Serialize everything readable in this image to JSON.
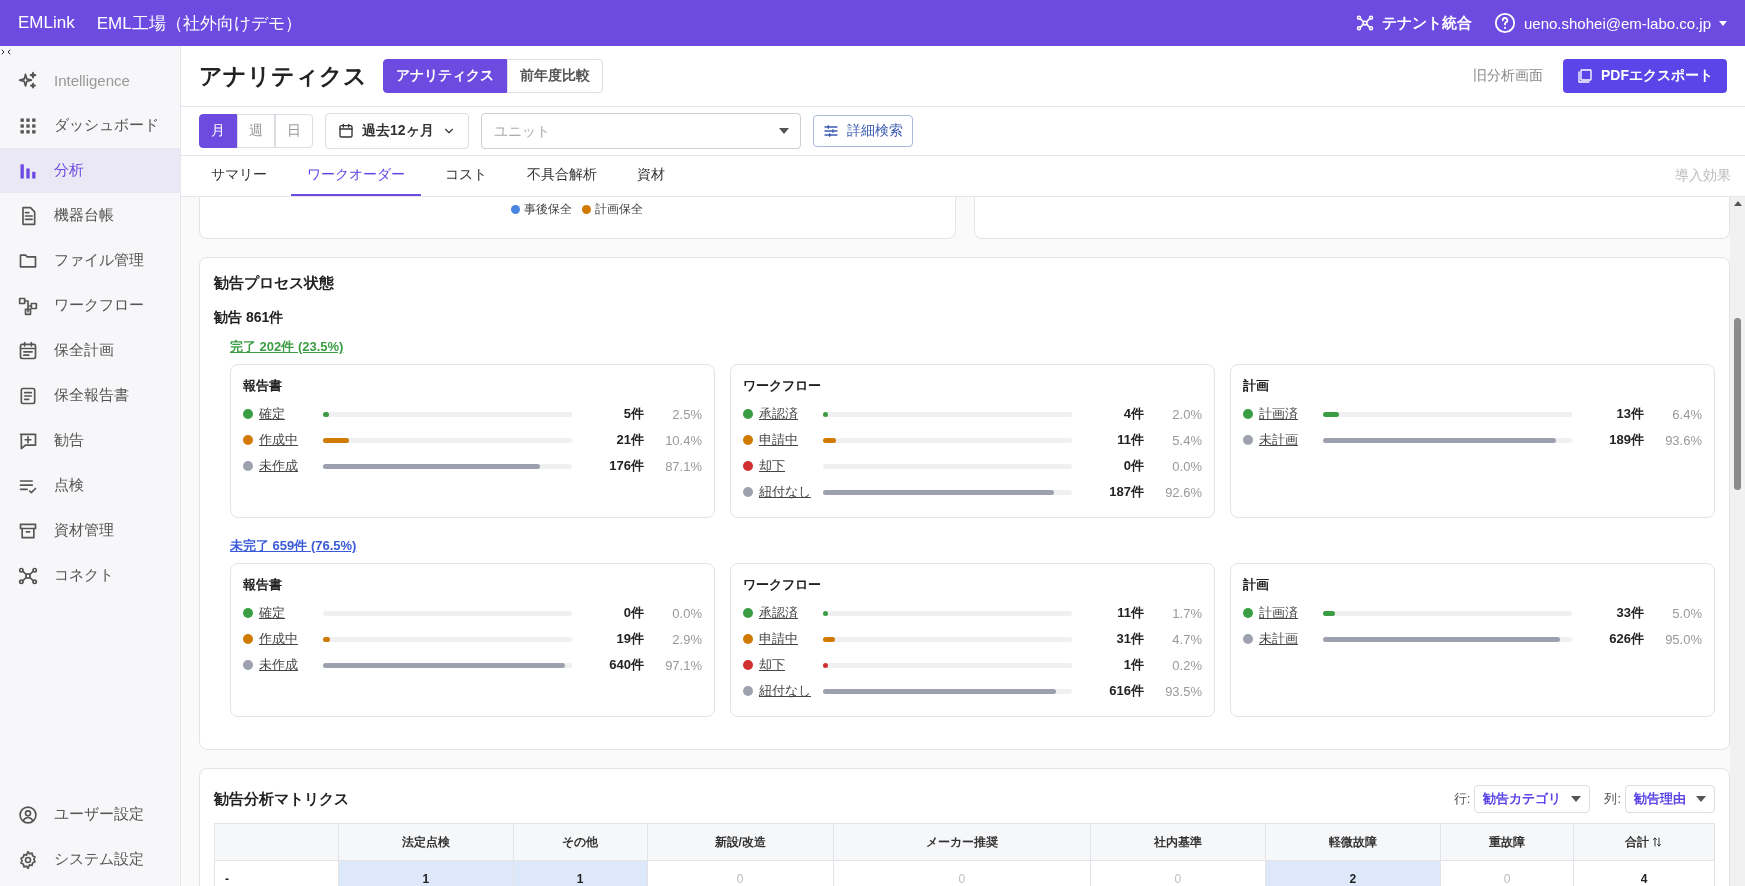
{
  "topbar": {
    "brand": "EMLink",
    "workspace": "EML工場（社外向けデモ）",
    "tenant": "テナント統合",
    "user": "ueno.shohei@em-labo.co.jp"
  },
  "sidebar": {
    "items": [
      {
        "label": "Intelligence",
        "selected": false,
        "disabled": true
      },
      {
        "label": "ダッシュボード",
        "selected": false,
        "disabled": false
      },
      {
        "label": "分析",
        "selected": true,
        "disabled": false
      },
      {
        "label": "機器台帳",
        "selected": false,
        "disabled": false
      },
      {
        "label": "ファイル管理",
        "selected": false,
        "disabled": false
      },
      {
        "label": "ワークフロー",
        "selected": false,
        "disabled": false
      },
      {
        "label": "保全計画",
        "selected": false,
        "disabled": false
      },
      {
        "label": "保全報告書",
        "selected": false,
        "disabled": false
      },
      {
        "label": "勧告",
        "selected": false,
        "disabled": false
      },
      {
        "label": "点検",
        "selected": false,
        "disabled": false
      },
      {
        "label": "資材管理",
        "selected": false,
        "disabled": false
      },
      {
        "label": "コネクト",
        "selected": false,
        "disabled": false
      }
    ],
    "bottom_items": [
      {
        "label": "ユーザー設定",
        "selected": false
      },
      {
        "label": "システム設定",
        "selected": false
      }
    ]
  },
  "header": {
    "title": "アナリティクス",
    "modes": [
      {
        "label": "アナリティクス",
        "selected": true
      },
      {
        "label": "前年度比較",
        "selected": false
      }
    ],
    "old_link": "旧分析画面",
    "export_button": "PDFエクスポート"
  },
  "filters": {
    "periods": [
      {
        "label": "月",
        "selected": true
      },
      {
        "label": "週",
        "selected": false
      },
      {
        "label": "日",
        "selected": false
      }
    ],
    "range": "過去12ヶ月",
    "unit_placeholder": "ユニット",
    "advanced_button": "詳細検索"
  },
  "tabs": [
    {
      "label": "サマリー",
      "selected": false
    },
    {
      "label": "ワークオーダー",
      "selected": true
    },
    {
      "label": "コスト",
      "selected": false
    },
    {
      "label": "不具合解析",
      "selected": false
    },
    {
      "label": "資材",
      "selected": false
    }
  ],
  "tab_right": {
    "label": "導入効果",
    "disabled": true
  },
  "top_legend": [
    {
      "label": "事後保全",
      "color": "#4a86e0"
    },
    {
      "label": "計画保全",
      "color": "#d17a00"
    }
  ],
  "process": {
    "title": "勧告プロセス状態",
    "total": "勧告 861件",
    "groups": [
      {
        "label": "完了 202件 (23.5%)",
        "kind": "done",
        "cards": [
          {
            "title": "報告書",
            "rows": [
              {
                "label": "確定",
                "color": "#3a9d44",
                "level": 0.025,
                "count": "5件",
                "pct": "2.5%"
              },
              {
                "label": "作成中",
                "color": "#d17a00",
                "level": 0.104,
                "count": "21件",
                "pct": "10.4%"
              },
              {
                "label": "未作成",
                "color": "#9ca1ad",
                "level": 0.871,
                "count": "176件",
                "pct": "87.1%"
              }
            ]
          },
          {
            "title": "ワークフロー",
            "rows": [
              {
                "label": "承認済",
                "color": "#3a9d44",
                "level": 0.02,
                "count": "4件",
                "pct": "2.0%"
              },
              {
                "label": "申請中",
                "color": "#d17a00",
                "level": 0.054,
                "count": "11件",
                "pct": "5.4%"
              },
              {
                "label": "却下",
                "color": "#d03030",
                "level": 0,
                "count": "0件",
                "pct": "0.0%"
              },
              {
                "label": "紐付なし",
                "color": "#9ca1ad",
                "level": 0.926,
                "count": "187件",
                "pct": "92.6%"
              }
            ]
          },
          {
            "title": "計画",
            "rows": [
              {
                "label": "計画済",
                "color": "#3a9d44",
                "level": 0.064,
                "count": "13件",
                "pct": "6.4%"
              },
              {
                "label": "未計画",
                "color": "#9ca1ad",
                "level": 0.936,
                "count": "189件",
                "pct": "93.6%"
              }
            ]
          }
        ]
      },
      {
        "label": "未完了 659件 (76.5%)",
        "kind": "open",
        "cards": [
          {
            "title": "報告書",
            "rows": [
              {
                "label": "確定",
                "color": "#3a9d44",
                "level": 0,
                "count": "0件",
                "pct": "0.0%"
              },
              {
                "label": "作成中",
                "color": "#d17a00",
                "level": 0.029,
                "count": "19件",
                "pct": "2.9%"
              },
              {
                "label": "未作成",
                "color": "#9ca1ad",
                "level": 0.971,
                "count": "640件",
                "pct": "97.1%"
              }
            ]
          },
          {
            "title": "ワークフロー",
            "rows": [
              {
                "label": "承認済",
                "color": "#3a9d44",
                "level": 0.017,
                "count": "11件",
                "pct": "1.7%"
              },
              {
                "label": "申請中",
                "color": "#d17a00",
                "level": 0.047,
                "count": "31件",
                "pct": "4.7%"
              },
              {
                "label": "却下",
                "color": "#d03030",
                "level": 0.002,
                "count": "1件",
                "pct": "0.2%"
              },
              {
                "label": "紐付なし",
                "color": "#9ca1ad",
                "level": 0.935,
                "count": "616件",
                "pct": "93.5%"
              }
            ]
          },
          {
            "title": "計画",
            "rows": [
              {
                "label": "計画済",
                "color": "#3a9d44",
                "level": 0.05,
                "count": "33件",
                "pct": "5.0%"
              },
              {
                "label": "未計画",
                "color": "#9ca1ad",
                "level": 0.95,
                "count": "626件",
                "pct": "95.0%"
              }
            ]
          }
        ]
      }
    ]
  },
  "matrix": {
    "title": "勧告分析マトリクス",
    "row_label": "行:",
    "row_select": "勧告カテゴリ",
    "col_label": "列:",
    "col_select": "勧告理由",
    "columns": [
      "法定点検",
      "その他",
      "新設/改造",
      "メーカー推奨",
      "社内基準",
      "軽微故障",
      "重故障",
      "合計"
    ],
    "rows": [
      {
        "label": "-",
        "cells": [
          {
            "text": "1",
            "highlighted": true
          },
          {
            "text": "1",
            "highlighted": true
          },
          {
            "text": "0",
            "highlighted": false
          },
          {
            "text": "0",
            "highlighted": false
          },
          {
            "text": "0",
            "highlighted": false
          },
          {
            "text": "2",
            "highlighted": true
          },
          {
            "text": "0",
            "highlighted": false
          }
        ],
        "total": "4"
      }
    ]
  }
}
